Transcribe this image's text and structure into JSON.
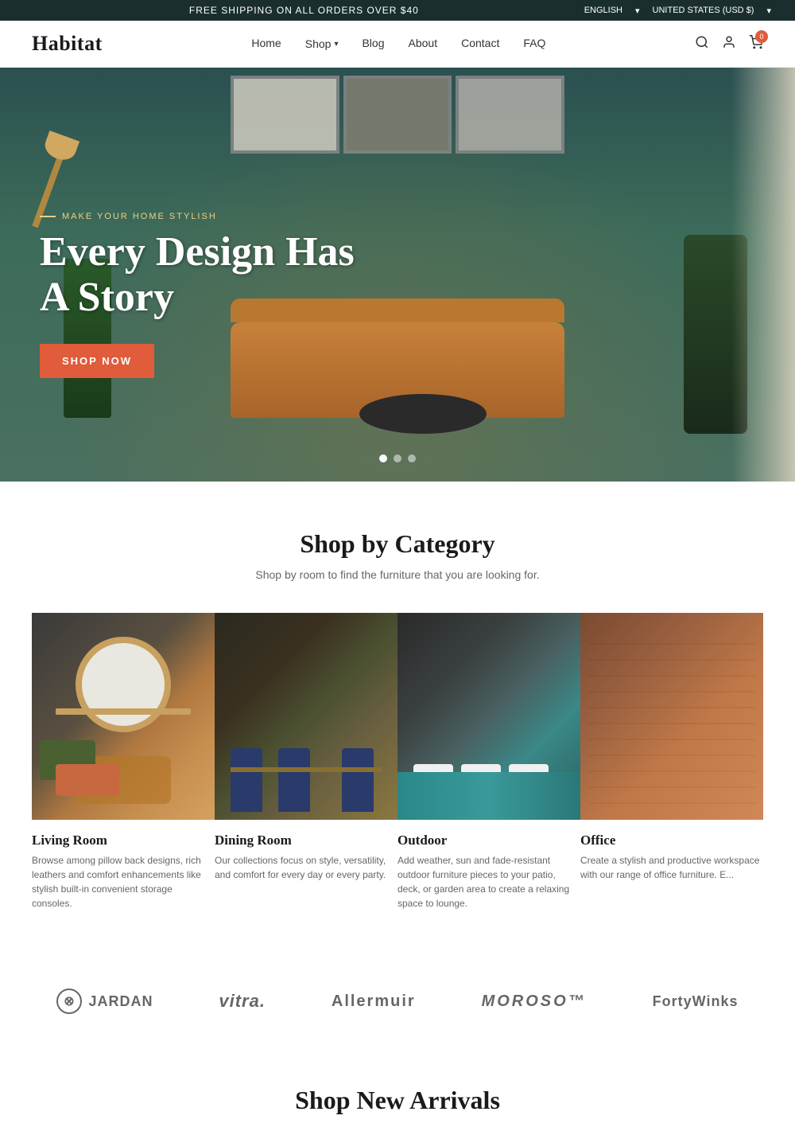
{
  "topbar": {
    "announcement": "FREE SHIPPING ON ALL ORDERS OVER $40",
    "language": "ENGLISH",
    "currency": "UNITED STATES (USD $)"
  },
  "header": {
    "logo": "Habitat",
    "nav": [
      {
        "label": "Home",
        "href": "#"
      },
      {
        "label": "Shop",
        "href": "#",
        "has_dropdown": true
      },
      {
        "label": "Blog",
        "href": "#"
      },
      {
        "label": "About",
        "href": "#"
      },
      {
        "label": "Contact",
        "href": "#"
      },
      {
        "label": "FAQ",
        "href": "#"
      }
    ],
    "cart_count": "0"
  },
  "hero": {
    "eyebrow": "MAKE YOUR HOME STYLISH",
    "title": "Every Design Has A Story",
    "cta_label": "SHOP NOW",
    "slides_count": 3,
    "active_slide": 0
  },
  "category_section": {
    "title": "Shop by Category",
    "subtitle": "Shop by room to find the furniture that you are looking for.",
    "categories": [
      {
        "name": "Living Room",
        "description": "Browse among pillow back designs, rich leathers and comfort enhancements like stylish built-in convenient storage consoles."
      },
      {
        "name": "Dining Room",
        "description": "Our collections focus on style, versatility, and comfort for every day or every party."
      },
      {
        "name": "Outdoor",
        "description": "Add weather, sun and fade-resistant outdoor furniture pieces to your patio, deck, or garden area to create a relaxing space to lounge."
      },
      {
        "name": "Office",
        "description": "Create a stylish and productive workspace with our range of office furniture. E..."
      }
    ]
  },
  "brands": {
    "items": [
      {
        "name": "JARDAN",
        "style": "jardan"
      },
      {
        "name": "vitra.",
        "style": "vitra"
      },
      {
        "name": "Allermuir",
        "style": "allermuir"
      },
      {
        "name": "MOROSO™",
        "style": "moroso"
      },
      {
        "name": "FortyWinks",
        "style": "fortywinks"
      }
    ]
  },
  "arrivals_section": {
    "title": "Shop New Arrivals"
  }
}
